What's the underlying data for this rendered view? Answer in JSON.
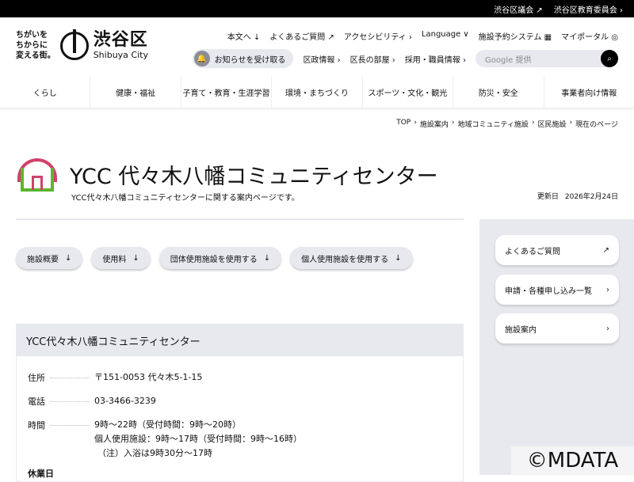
{
  "topbar": {
    "links": [
      "渋谷区議会 ↗",
      "渋谷区教育委員会 ›"
    ]
  },
  "logo": {
    "tagline": [
      "ちがいを",
      "ちからに",
      "変える街。"
    ],
    "name": "渋谷区",
    "name_en": "Shibuya City"
  },
  "util": [
    "本文へ ↓",
    "よくあるご質問 ↗",
    "アクセシビリティ ›",
    "Language ∨",
    "施設予約システム ▦",
    "マイポータル ◎"
  ],
  "util2": {
    "notify": "お知らせを受け取る",
    "links": [
      "区政情報 ›",
      "区長の部屋 ›",
      "採用・職員情報 ›"
    ],
    "search_placeholder": "Google 提供"
  },
  "nav": [
    "くらし",
    "健康・福祉",
    "子育て・教育・生涯学習",
    "環境・まちづくり",
    "スポーツ・文化・観光",
    "防災・安全",
    "事業者向け情報"
  ],
  "breadcrumb": [
    "TOP",
    "›",
    "施設案内",
    "›",
    "地域コミュニティ施設",
    "›",
    "区民施設",
    "›",
    "現在のページ"
  ],
  "page": {
    "title": "YCC 代々木八幡コミュニティセンター",
    "subtitle": "YCC代々木八幡コミュニティセンターに関する案内ページです。",
    "updated_label": "更新日",
    "updated": "2026年2月24日"
  },
  "anchors": [
    "施設概要",
    "使用料",
    "団体使用施設を使用する",
    "個人使用施設を使用する"
  ],
  "sidebar": [
    {
      "label": "よくあるご質問",
      "icon": "↗"
    },
    {
      "label": "申請・各種申し込み一覧",
      "icon": "›"
    },
    {
      "label": "施設案内",
      "icon": "›"
    }
  ],
  "info": {
    "heading": "YCC代々木八幡コミュニティセンター",
    "address_label": "住所",
    "address": "〒151-0053 代々木5-1-15",
    "phone_label": "電話",
    "phone": "03-3466-3239",
    "hours_label": "時間",
    "hours": [
      "9時～22時（受付時間：9時～20時）",
      "個人使用施設：9時～17時（受付時間：9時～16時）",
      "（注）入浴は9時30分～17時"
    ],
    "closed_label": "休業日"
  },
  "watermark": "©MDATA"
}
